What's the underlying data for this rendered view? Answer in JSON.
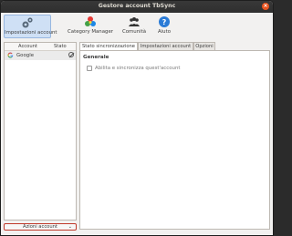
{
  "window": {
    "title": "Gestore account TbSync",
    "close_icon": "×"
  },
  "toolbar": {
    "items": [
      {
        "label": "Impostazioni account",
        "icon": "gear-icon"
      },
      {
        "label": "Category Manager",
        "icon": "category-circles-icon"
      },
      {
        "label": "Comunità",
        "icon": "people-icon"
      },
      {
        "label": "Aiuto",
        "icon": "help-icon"
      }
    ]
  },
  "accounts": {
    "headers": {
      "account": "Account",
      "status": "Stato"
    },
    "rows": [
      {
        "name": "Google",
        "icon": "google-icon",
        "status_icon": "disabled-icon"
      }
    ],
    "actions_label": "Azioni account",
    "actions_arrow": "⌄"
  },
  "tabs": [
    {
      "label": "Stato sincronizzazione"
    },
    {
      "label": "Impostazioni account"
    },
    {
      "label": "Opzioni"
    }
  ],
  "panel": {
    "section_title": "Generale",
    "checkbox_label": "Abilita e sincronizza quest'account"
  },
  "colors": {
    "accent": "#e95420",
    "selected_tool": "#cfe0f5",
    "titlebar": "#333333"
  }
}
